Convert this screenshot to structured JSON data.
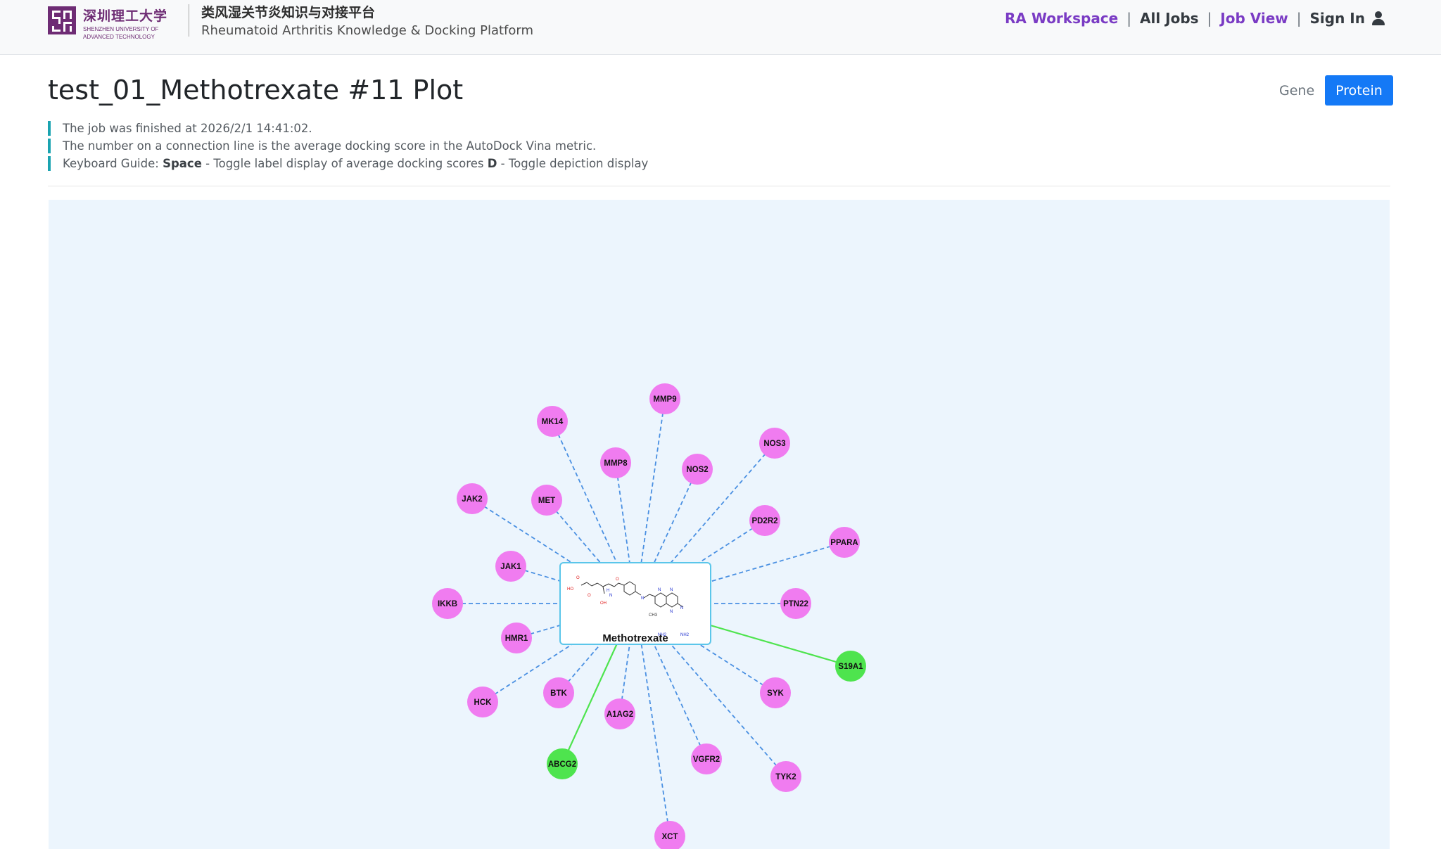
{
  "header": {
    "logo_cn": "深圳理工大学",
    "logo_en_line1": "SHENZHEN UNIVERSITY OF",
    "logo_en_line2": "ADVANCED TECHNOLOGY",
    "platform_cn": "类风湿关节炎知识与对接平台",
    "platform_en": "Rheumatoid Arthritis Knowledge & Docking Platform",
    "nav": {
      "workspace": "RA Workspace",
      "all_jobs": "All Jobs",
      "job_view": "Job View",
      "sign_in": "Sign In",
      "separator": "|"
    }
  },
  "main": {
    "title": "test_01_Methotrexate #11 Plot",
    "toggle": {
      "gene": "Gene",
      "protein": "Protein",
      "active": "Protein"
    },
    "notes": {
      "finished": "The job was finished at 2026/2/1 14:41:02.",
      "score_info": "The number on a connection line is the average docking score in the AutoDock Vina metric.",
      "kb_prefix": "Keyboard Guide: ",
      "kb_space": "Space",
      "kb_space_desc": " - Toggle label display of average docking scores ",
      "kb_d": "D",
      "kb_d_desc": " - Toggle depiction display"
    }
  },
  "network": {
    "center": {
      "label": "Methotrexate",
      "atom_labels": [
        "HO",
        "O",
        "OH",
        "O",
        "H",
        "N",
        "O",
        "N",
        "N",
        "N",
        "N",
        "N",
        "NH2",
        "NH2",
        "CH3"
      ]
    },
    "colors": {
      "target": "#f07cf0",
      "highlight": "#4ee44e",
      "edge": "#4a90e2",
      "highlight_edge": "#4ee44e",
      "box_border": "#5bc6ea"
    },
    "nodes": [
      {
        "label": "MMP9",
        "highlight": false
      },
      {
        "label": "MK14",
        "highlight": false
      },
      {
        "label": "NOS3",
        "highlight": false
      },
      {
        "label": "MMP8",
        "highlight": false
      },
      {
        "label": "NOS2",
        "highlight": false
      },
      {
        "label": "JAK2",
        "highlight": false
      },
      {
        "label": "MET",
        "highlight": false
      },
      {
        "label": "PD2R2",
        "highlight": false
      },
      {
        "label": "PPARA",
        "highlight": false
      },
      {
        "label": "JAK1",
        "highlight": false
      },
      {
        "label": "IKKB",
        "highlight": false
      },
      {
        "label": "PTN22",
        "highlight": false
      },
      {
        "label": "HMR1",
        "highlight": false
      },
      {
        "label": "S19A1",
        "highlight": true
      },
      {
        "label": "HCK",
        "highlight": false
      },
      {
        "label": "BTK",
        "highlight": false
      },
      {
        "label": "SYK",
        "highlight": false
      },
      {
        "label": "A1AG2",
        "highlight": false
      },
      {
        "label": "VGFR2",
        "highlight": false
      },
      {
        "label": "ABCG2",
        "highlight": true
      },
      {
        "label": "TYK2",
        "highlight": false
      },
      {
        "label": "XCT",
        "highlight": false
      }
    ]
  }
}
